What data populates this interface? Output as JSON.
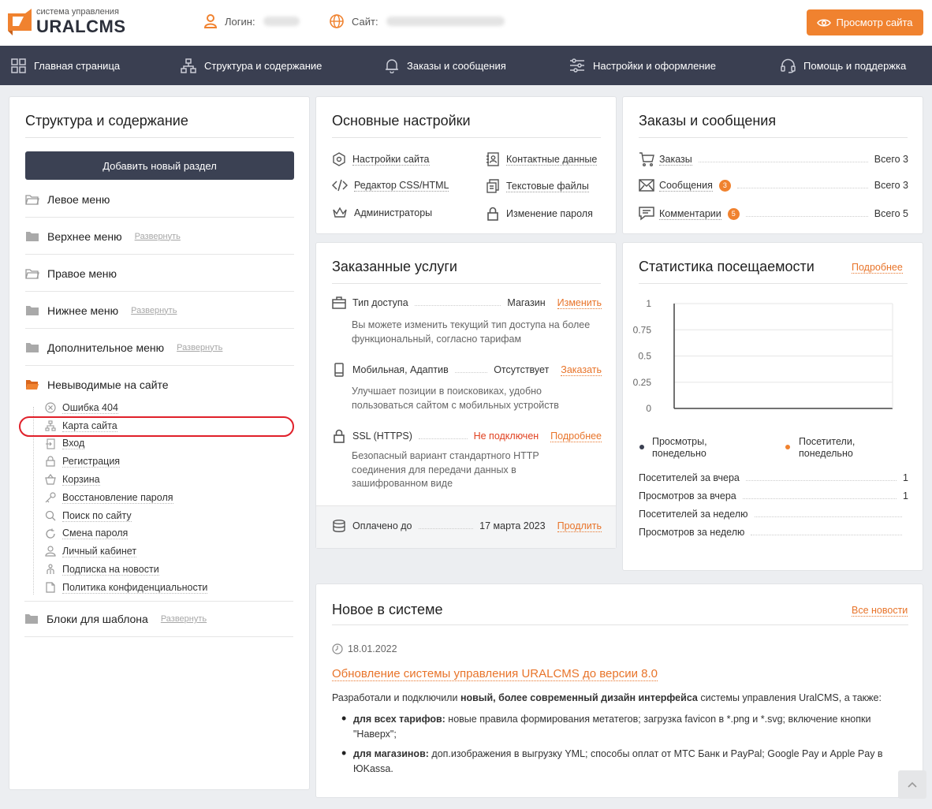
{
  "header": {
    "logo_small": "система управления",
    "logo_big": "URALCMS",
    "login_label": "Логин:",
    "site_label": "Сайт:",
    "view_site_button": "Просмотр сайта"
  },
  "nav": [
    {
      "label": "Главная страница",
      "icon": "grid-icon"
    },
    {
      "label": "Структура и содержание",
      "icon": "sitemap-icon"
    },
    {
      "label": "Заказы и сообщения",
      "icon": "bell-icon"
    },
    {
      "label": "Настройки и оформление",
      "icon": "sliders-icon"
    },
    {
      "label": "Помощь и поддержка",
      "icon": "headset-icon"
    }
  ],
  "structure": {
    "title": "Структура и содержание",
    "add_button": "Добавить новый раздел",
    "expand_label": "Развернуть",
    "menus": [
      {
        "label": "Левое меню"
      },
      {
        "label": "Верхнее меню"
      },
      {
        "label": "Правое меню"
      },
      {
        "label": "Нижнее меню"
      },
      {
        "label": "Дополнительное меню"
      },
      {
        "label": "Невыводимые на сайте"
      }
    ],
    "hidden_pages": [
      {
        "label": "Ошибка 404",
        "icon": "error-circle-icon"
      },
      {
        "label": "Карта сайта",
        "icon": "sitemap-icon"
      },
      {
        "label": "Вход",
        "icon": "login-icon"
      },
      {
        "label": "Регистрация",
        "icon": "lock-icon"
      },
      {
        "label": "Корзина",
        "icon": "basket-icon"
      },
      {
        "label": "Восстановление пароля",
        "icon": "key-icon"
      },
      {
        "label": "Поиск по сайту",
        "icon": "search-icon"
      },
      {
        "label": "Смена пароля",
        "icon": "refresh-icon"
      },
      {
        "label": "Личный кабинет",
        "icon": "user-icon"
      },
      {
        "label": "Подписка на новости",
        "icon": "subscribe-icon"
      },
      {
        "label": "Политика конфиденциальности",
        "icon": "document-icon"
      }
    ],
    "blocks_label": "Блоки для шаблона"
  },
  "settings": {
    "title": "Основные настройки",
    "items": [
      {
        "label": "Настройки сайта",
        "icon": "settings-hex-icon"
      },
      {
        "label": "Контактные данные",
        "icon": "contacts-icon"
      },
      {
        "label": "Редактор CSS/HTML",
        "icon": "code-icon"
      },
      {
        "label": "Текстовые файлы",
        "icon": "files-icon"
      },
      {
        "label": "Администраторы",
        "icon": "crown-icon"
      },
      {
        "label": "Изменение пароля",
        "icon": "lock-icon"
      }
    ]
  },
  "orders": {
    "title": "Заказы и сообщения",
    "items": [
      {
        "label": "Заказы",
        "badge": "",
        "total": "Всего 3",
        "icon": "cart-icon"
      },
      {
        "label": "Сообщения",
        "badge": "3",
        "total": "Всего 3",
        "icon": "envelope-icon"
      },
      {
        "label": "Комментарии",
        "badge": "5",
        "total": "Всего 5",
        "icon": "comment-icon"
      }
    ]
  },
  "services": {
    "title": "Заказанные услуги",
    "access_label": "Тип доступа",
    "access_value": "Магазин",
    "access_action": "Изменить",
    "access_desc": "Вы можете изменить текущий тип доступа на более функциональный, согласно тарифам",
    "mobile_label": "Мобильная, Адаптив",
    "mobile_value": "Отсутствует",
    "mobile_action": "Заказать",
    "mobile_desc": "Улучшает позиции в поисковиках, удобно пользоваться сайтом с мобильных устройств",
    "ssl_label": "SSL (HTTPS)",
    "ssl_value": "Не подключен",
    "ssl_action": "Подробнее",
    "ssl_desc": "Безопасный вариант стандартного HTTP соединения для передачи данных в зашифрованном виде",
    "paid_label": "Оплачено до",
    "paid_value": "17 марта 2023",
    "paid_action": "Продлить"
  },
  "stats": {
    "title": "Статистика посещаемости",
    "more_link": "Подробнее",
    "legend_views": "Просмотры, понедельно",
    "legend_visitors": "Посетители, понедельно",
    "colors": {
      "views": "#3a3f51",
      "visitors": "#f0822f"
    },
    "rows": [
      {
        "label": "Посетителей за вчера",
        "value": "1"
      },
      {
        "label": "Просмотров за вчера",
        "value": "1"
      },
      {
        "label": "Посетителей за неделю",
        "value": ""
      },
      {
        "label": "Просмотров за неделю",
        "value": ""
      }
    ]
  },
  "chart_data": {
    "type": "line",
    "yticks": [
      "1",
      "0.75",
      "0.5",
      "0.25",
      "0"
    ],
    "ylim": [
      0,
      1
    ],
    "grid": true,
    "legend_placement": "bottom",
    "series": [
      {
        "name": "Просмотры, понедельно",
        "values": []
      },
      {
        "name": "Посетители, понедельно",
        "values": []
      }
    ]
  },
  "news": {
    "title": "Новое в системе",
    "all_link": "Все новости",
    "date": "18.01.2022",
    "headline": "Обновление системы управления URALCMS до версии 8.0",
    "intro_before": "Разработали и подключили ",
    "intro_bold": "новый, более современный дизайн интерфейса",
    "intro_after": " системы управления UralCMS, а также:",
    "bullets": [
      {
        "bold": "для всех тарифов:",
        "text": " новые правила формирования метатегов; загрузка favicon в *.png и *.svg; включение кнопки \"Наверх\";"
      },
      {
        "bold": "для магазинов:",
        "text": " доп.изображения в выгрузку YML; способы оплат от МТС Банк и PayPal; Google Pay и Apple Pay в ЮKassa."
      }
    ]
  },
  "theme": {
    "accent": "#f0822f",
    "nav_bg": "#3a3f51",
    "highlight": "#e0202a"
  }
}
